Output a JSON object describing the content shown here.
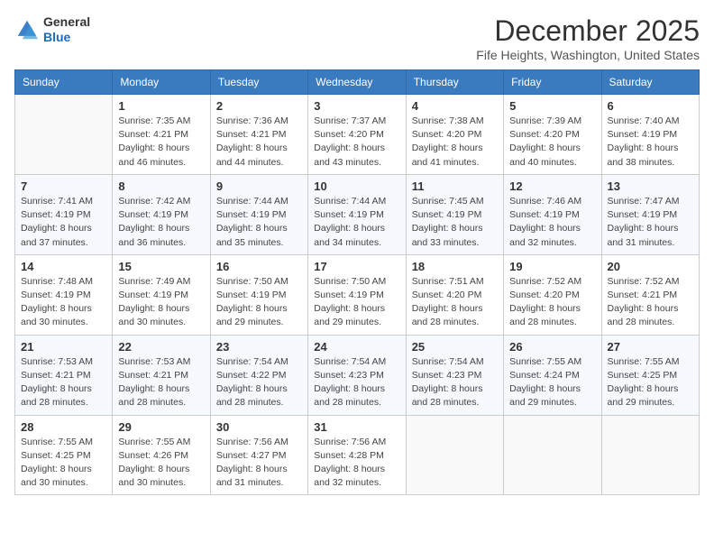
{
  "header": {
    "logo_general": "General",
    "logo_blue": "Blue",
    "month_year": "December 2025",
    "location": "Fife Heights, Washington, United States"
  },
  "weekdays": [
    "Sunday",
    "Monday",
    "Tuesday",
    "Wednesday",
    "Thursday",
    "Friday",
    "Saturday"
  ],
  "weeks": [
    [
      {
        "day": "",
        "info": ""
      },
      {
        "day": "1",
        "info": "Sunrise: 7:35 AM\nSunset: 4:21 PM\nDaylight: 8 hours\nand 46 minutes."
      },
      {
        "day": "2",
        "info": "Sunrise: 7:36 AM\nSunset: 4:21 PM\nDaylight: 8 hours\nand 44 minutes."
      },
      {
        "day": "3",
        "info": "Sunrise: 7:37 AM\nSunset: 4:20 PM\nDaylight: 8 hours\nand 43 minutes."
      },
      {
        "day": "4",
        "info": "Sunrise: 7:38 AM\nSunset: 4:20 PM\nDaylight: 8 hours\nand 41 minutes."
      },
      {
        "day": "5",
        "info": "Sunrise: 7:39 AM\nSunset: 4:20 PM\nDaylight: 8 hours\nand 40 minutes."
      },
      {
        "day": "6",
        "info": "Sunrise: 7:40 AM\nSunset: 4:19 PM\nDaylight: 8 hours\nand 38 minutes."
      }
    ],
    [
      {
        "day": "7",
        "info": "Sunrise: 7:41 AM\nSunset: 4:19 PM\nDaylight: 8 hours\nand 37 minutes."
      },
      {
        "day": "8",
        "info": "Sunrise: 7:42 AM\nSunset: 4:19 PM\nDaylight: 8 hours\nand 36 minutes."
      },
      {
        "day": "9",
        "info": "Sunrise: 7:44 AM\nSunset: 4:19 PM\nDaylight: 8 hours\nand 35 minutes."
      },
      {
        "day": "10",
        "info": "Sunrise: 7:44 AM\nSunset: 4:19 PM\nDaylight: 8 hours\nand 34 minutes."
      },
      {
        "day": "11",
        "info": "Sunrise: 7:45 AM\nSunset: 4:19 PM\nDaylight: 8 hours\nand 33 minutes."
      },
      {
        "day": "12",
        "info": "Sunrise: 7:46 AM\nSunset: 4:19 PM\nDaylight: 8 hours\nand 32 minutes."
      },
      {
        "day": "13",
        "info": "Sunrise: 7:47 AM\nSunset: 4:19 PM\nDaylight: 8 hours\nand 31 minutes."
      }
    ],
    [
      {
        "day": "14",
        "info": "Sunrise: 7:48 AM\nSunset: 4:19 PM\nDaylight: 8 hours\nand 30 minutes."
      },
      {
        "day": "15",
        "info": "Sunrise: 7:49 AM\nSunset: 4:19 PM\nDaylight: 8 hours\nand 30 minutes."
      },
      {
        "day": "16",
        "info": "Sunrise: 7:50 AM\nSunset: 4:19 PM\nDaylight: 8 hours\nand 29 minutes."
      },
      {
        "day": "17",
        "info": "Sunrise: 7:50 AM\nSunset: 4:19 PM\nDaylight: 8 hours\nand 29 minutes."
      },
      {
        "day": "18",
        "info": "Sunrise: 7:51 AM\nSunset: 4:20 PM\nDaylight: 8 hours\nand 28 minutes."
      },
      {
        "day": "19",
        "info": "Sunrise: 7:52 AM\nSunset: 4:20 PM\nDaylight: 8 hours\nand 28 minutes."
      },
      {
        "day": "20",
        "info": "Sunrise: 7:52 AM\nSunset: 4:21 PM\nDaylight: 8 hours\nand 28 minutes."
      }
    ],
    [
      {
        "day": "21",
        "info": "Sunrise: 7:53 AM\nSunset: 4:21 PM\nDaylight: 8 hours\nand 28 minutes."
      },
      {
        "day": "22",
        "info": "Sunrise: 7:53 AM\nSunset: 4:21 PM\nDaylight: 8 hours\nand 28 minutes."
      },
      {
        "day": "23",
        "info": "Sunrise: 7:54 AM\nSunset: 4:22 PM\nDaylight: 8 hours\nand 28 minutes."
      },
      {
        "day": "24",
        "info": "Sunrise: 7:54 AM\nSunset: 4:23 PM\nDaylight: 8 hours\nand 28 minutes."
      },
      {
        "day": "25",
        "info": "Sunrise: 7:54 AM\nSunset: 4:23 PM\nDaylight: 8 hours\nand 28 minutes."
      },
      {
        "day": "26",
        "info": "Sunrise: 7:55 AM\nSunset: 4:24 PM\nDaylight: 8 hours\nand 29 minutes."
      },
      {
        "day": "27",
        "info": "Sunrise: 7:55 AM\nSunset: 4:25 PM\nDaylight: 8 hours\nand 29 minutes."
      }
    ],
    [
      {
        "day": "28",
        "info": "Sunrise: 7:55 AM\nSunset: 4:25 PM\nDaylight: 8 hours\nand 30 minutes."
      },
      {
        "day": "29",
        "info": "Sunrise: 7:55 AM\nSunset: 4:26 PM\nDaylight: 8 hours\nand 30 minutes."
      },
      {
        "day": "30",
        "info": "Sunrise: 7:56 AM\nSunset: 4:27 PM\nDaylight: 8 hours\nand 31 minutes."
      },
      {
        "day": "31",
        "info": "Sunrise: 7:56 AM\nSunset: 4:28 PM\nDaylight: 8 hours\nand 32 minutes."
      },
      {
        "day": "",
        "info": ""
      },
      {
        "day": "",
        "info": ""
      },
      {
        "day": "",
        "info": ""
      }
    ]
  ]
}
